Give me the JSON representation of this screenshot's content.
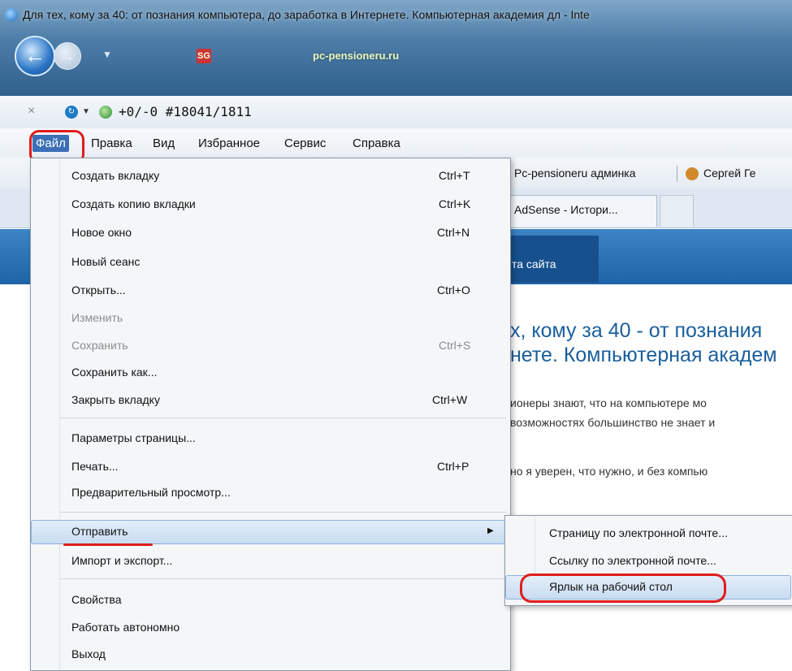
{
  "window": {
    "title": "Для тех, кому за 40: от познания компьютера, до заработка в Интернете. Компьютерная академия дл - Inte"
  },
  "address": {
    "site_badge": "SG",
    "url": "pc-pensioneru.ru"
  },
  "toolbar": {
    "close": "×",
    "counter": "+0/-0  #18041/1811"
  },
  "menubar": {
    "items": [
      "Файл",
      "Правка",
      "Вид",
      "Избранное",
      "Сервис",
      "Справка"
    ]
  },
  "favorites": {
    "items": [
      "Pc-pensioneru админка",
      "Сергей Ге"
    ]
  },
  "tabs": {
    "items": [
      "AdSense - Истори..."
    ]
  },
  "site": {
    "nav_label": "та сайта",
    "title": "х, кому за 40 - от познания\nнете. Компьютерная академ",
    "paragraphs": [
      "ионеры знают, что на компьютере мо",
      "возможностях большинство не знает и",
      "но я уверен, что нужно, и без компью"
    ]
  },
  "file_menu": {
    "items": [
      {
        "label": "Создать вкладку",
        "shortcut": "Ctrl+T"
      },
      {
        "label": "Создать копию вкладки",
        "shortcut": "Ctrl+K"
      },
      {
        "label": "Новое окно",
        "shortcut": "Ctrl+N"
      },
      {
        "label": "Новый сеанс",
        "shortcut": ""
      },
      {
        "label": "Открыть...",
        "shortcut": "Ctrl+O"
      },
      {
        "label": "Изменить",
        "shortcut": ""
      },
      {
        "label": "Сохранить",
        "shortcut": "Ctrl+S"
      },
      {
        "label": "Сохранить как...",
        "shortcut": ""
      },
      {
        "label": "Закрыть вкладку",
        "shortcut": "Ctrl+W"
      },
      {
        "label": "Параметры страницы...",
        "shortcut": ""
      },
      {
        "label": "Печать...",
        "shortcut": "Ctrl+P"
      },
      {
        "label": "Предварительный просмотр...",
        "shortcut": ""
      },
      {
        "label": "Отправить",
        "shortcut": ""
      },
      {
        "label": "Импорт и экспорт...",
        "shortcut": ""
      },
      {
        "label": "Свойства",
        "shortcut": ""
      },
      {
        "label": "Работать автономно",
        "shortcut": ""
      },
      {
        "label": "Выход",
        "shortcut": ""
      }
    ]
  },
  "send_submenu": {
    "items": [
      "Страницу по электронной почте...",
      "Ссылку по электронной почте...",
      "Ярлык на рабочий стол"
    ]
  },
  "colors": {
    "menu_highlight": "#3b6fb6",
    "annotation_red": "#e01c1c",
    "site_nav_blue": "#1f64a8"
  }
}
